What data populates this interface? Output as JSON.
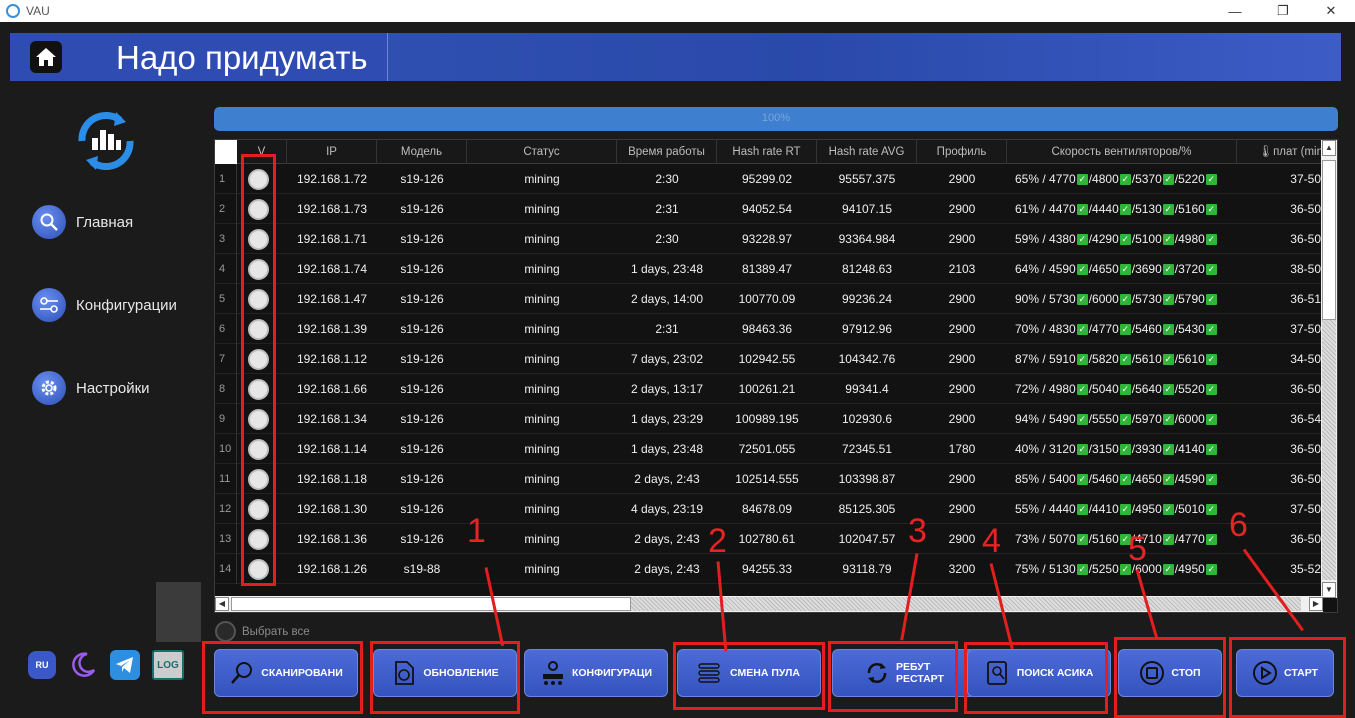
{
  "window": {
    "title": "VAU",
    "min": "—",
    "max": "❐",
    "close": "✕"
  },
  "header": {
    "title": "Надо придумать"
  },
  "sidebar": {
    "items": [
      {
        "label": "Главная",
        "icon": "search-icon"
      },
      {
        "label": "Конфигурации",
        "icon": "config-icon"
      },
      {
        "label": "Настройки",
        "icon": "gear-icon"
      }
    ],
    "bottom": {
      "lang": "RU",
      "log": "LOG"
    }
  },
  "progress": {
    "value": 100,
    "label": "100%"
  },
  "table": {
    "columns": [
      "V",
      "IP",
      "Модель",
      "Статус",
      "Время работы",
      "Hash rate RT",
      "Hash rate AVG",
      "Профиль",
      "Скорость вентиляторов/%",
      "🌡плат (min"
    ],
    "rows": [
      {
        "n": "1",
        "ip": "192.168.1.72",
        "model": "s19-126",
        "status": "mining",
        "uptime": "2:30",
        "rt": "95299.02",
        "avg": "95557.375",
        "profile": "2900",
        "fans": [
          "65% / 4770",
          "/4800",
          "/5370",
          "/5220"
        ],
        "temp": "37-50"
      },
      {
        "n": "2",
        "ip": "192.168.1.73",
        "model": "s19-126",
        "status": "mining",
        "uptime": "2:31",
        "rt": "94052.54",
        "avg": "94107.15",
        "profile": "2900",
        "fans": [
          "61% / 4470",
          "/4440",
          "/5130",
          "/5160"
        ],
        "temp": "36-50"
      },
      {
        "n": "3",
        "ip": "192.168.1.71",
        "model": "s19-126",
        "status": "mining",
        "uptime": "2:30",
        "rt": "93228.97",
        "avg": "93364.984",
        "profile": "2900",
        "fans": [
          "59% / 4380",
          "/4290",
          "/5100",
          "/4980"
        ],
        "temp": "36-50"
      },
      {
        "n": "4",
        "ip": "192.168.1.74",
        "model": "s19-126",
        "status": "mining",
        "uptime": "1 days, 23:48",
        "rt": "81389.47",
        "avg": "81248.63",
        "profile": "2103",
        "fans": [
          "64% / 4590",
          "/4650",
          "/3690",
          "/3720"
        ],
        "temp": "38-50"
      },
      {
        "n": "5",
        "ip": "192.168.1.47",
        "model": "s19-126",
        "status": "mining",
        "uptime": "2 days, 14:00",
        "rt": "100770.09",
        "avg": "99236.24",
        "profile": "2900",
        "fans": [
          "90% / 5730",
          "/6000",
          "/5730",
          "/5790"
        ],
        "temp": "36-51"
      },
      {
        "n": "6",
        "ip": "192.168.1.39",
        "model": "s19-126",
        "status": "mining",
        "uptime": "2:31",
        "rt": "98463.36",
        "avg": "97912.96",
        "profile": "2900",
        "fans": [
          "70% / 4830",
          "/4770",
          "/5460",
          "/5430"
        ],
        "temp": "37-50"
      },
      {
        "n": "7",
        "ip": "192.168.1.12",
        "model": "s19-126",
        "status": "mining",
        "uptime": "7 days, 23:02",
        "rt": "102942.55",
        "avg": "104342.76",
        "profile": "2900",
        "fans": [
          "87% / 5910",
          "/5820",
          "/5610",
          "/5610"
        ],
        "temp": "34-50"
      },
      {
        "n": "8",
        "ip": "192.168.1.66",
        "model": "s19-126",
        "status": "mining",
        "uptime": "2 days, 13:17",
        "rt": "100261.21",
        "avg": "99341.4",
        "profile": "2900",
        "fans": [
          "72% / 4980",
          "/5040",
          "/5640",
          "/5520"
        ],
        "temp": "36-50"
      },
      {
        "n": "9",
        "ip": "192.168.1.34",
        "model": "s19-126",
        "status": "mining",
        "uptime": "1 days, 23:29",
        "rt": "100989.195",
        "avg": "102930.6",
        "profile": "2900",
        "fans": [
          "94% / 5490",
          "/5550",
          "/5970",
          "/6000"
        ],
        "temp": "36-54"
      },
      {
        "n": "10",
        "ip": "192.168.1.14",
        "model": "s19-126",
        "status": "mining",
        "uptime": "1 days, 23:48",
        "rt": "72501.055",
        "avg": "72345.51",
        "profile": "1780",
        "fans": [
          "40% / 3120",
          "/3150",
          "/3930",
          "/4140"
        ],
        "temp": "36-50"
      },
      {
        "n": "11",
        "ip": "192.168.1.18",
        "model": "s19-126",
        "status": "mining",
        "uptime": "2 days, 2:43",
        "rt": "102514.555",
        "avg": "103398.87",
        "profile": "2900",
        "fans": [
          "85% / 5400",
          "/5460",
          "/4650",
          "/4590"
        ],
        "temp": "36-50"
      },
      {
        "n": "12",
        "ip": "192.168.1.30",
        "model": "s19-126",
        "status": "mining",
        "uptime": "4 days, 23:19",
        "rt": "84678.09",
        "avg": "85125.305",
        "profile": "2900",
        "fans": [
          "55% / 4440",
          "/4410",
          "/4950",
          "/5010"
        ],
        "temp": "37-50"
      },
      {
        "n": "13",
        "ip": "192.168.1.36",
        "model": "s19-126",
        "status": "mining",
        "uptime": "2 days, 2:43",
        "rt": "102780.61",
        "avg": "102047.57",
        "profile": "2900",
        "fans": [
          "73% / 5070",
          "/5160",
          "/4710",
          "/4770"
        ],
        "temp": "36-50"
      },
      {
        "n": "14",
        "ip": "192.168.1.26",
        "model": "s19-88",
        "status": "mining",
        "uptime": "2 days, 2:43",
        "rt": "94255.33",
        "avg": "93118.79",
        "profile": "3200",
        "fans": [
          "75% / 5130",
          "/5250",
          "/6000",
          "/4950"
        ],
        "temp": "35-52"
      }
    ],
    "select_all": "Выбрать все"
  },
  "actions": [
    {
      "label": "СКАНИРОВАНИ",
      "icon": "search-icon"
    },
    {
      "label": "ОБНОВЛЕНИЕ",
      "icon": "update-icon"
    },
    {
      "label": "КОНФИГУРАЦИ",
      "icon": "config-icon"
    },
    {
      "label": "СМЕНА ПУЛА",
      "icon": "pool-icon"
    },
    {
      "label": "РЕБУТ\nРЕСТАРТ",
      "icon": "refresh-icon"
    },
    {
      "label": "ПОИСК АСИКА",
      "icon": "find-device-icon"
    },
    {
      "label": "СТОП",
      "icon": "stop-icon"
    },
    {
      "label": "СТАРТ",
      "icon": "play-icon"
    }
  ],
  "annotations": [
    "1",
    "2",
    "3",
    "4",
    "5",
    "6"
  ],
  "colors": {
    "accent": "#3e63c7",
    "highlight": "#e21e1e",
    "ok": "#2fb53a"
  }
}
